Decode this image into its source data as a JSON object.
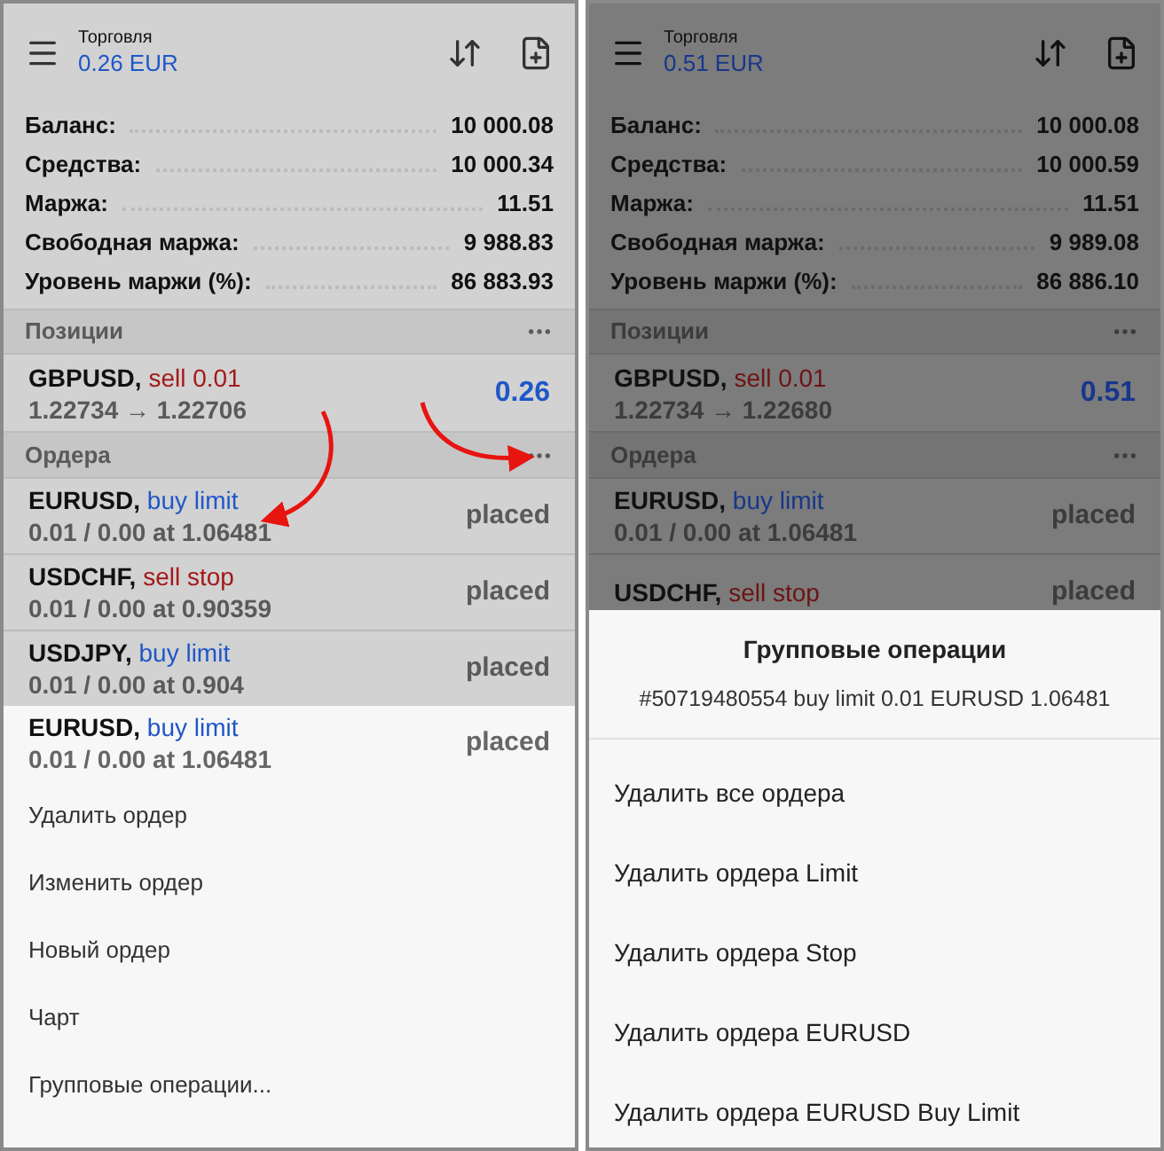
{
  "panels": [
    {
      "kind": "context_menu",
      "header": {
        "title": "Торговля",
        "profit": "0.26 EUR"
      },
      "account": [
        {
          "label": "Баланс:",
          "value": "10 000.08"
        },
        {
          "label": "Средства:",
          "value": "10 000.34"
        },
        {
          "label": "Маржа:",
          "value": "11.51"
        },
        {
          "label": "Свободная маржа:",
          "value": "9 988.83"
        },
        {
          "label": "Уровень маржи (%):",
          "value": "86 883.93"
        }
      ],
      "positions": {
        "title": "Позиции",
        "items": [
          {
            "symbol": "GBPUSD,",
            "kind": "sell",
            "trade": "sell 0.01",
            "prices": "1.22734 → 1.22706",
            "profit": "0.26"
          }
        ]
      },
      "orders": {
        "title": "Ордера",
        "items": [
          {
            "symbol": "EURUSD,",
            "kind": "buy",
            "type": "buy limit",
            "details": "0.01 / 0.00 at 1.06481",
            "status": "placed"
          },
          {
            "symbol": "USDCHF,",
            "kind": "sell",
            "type": "sell stop",
            "details": "0.01 / 0.00 at 0.90359",
            "status": "placed"
          },
          {
            "symbol": "USDJPY,",
            "kind": "buy",
            "type": "buy limit",
            "details": "0.01 / 0.00 at 0.904",
            "status": "placed"
          }
        ]
      },
      "popup": {
        "selected_order": {
          "symbol": "EURUSD,",
          "kind": "buy",
          "type": "buy limit",
          "details": "0.01 / 0.00 at 1.06481",
          "status": "placed"
        },
        "items": [
          "Удалить ордер",
          "Изменить ордер",
          "Новый ордер",
          "Чарт",
          "Групповые операции..."
        ]
      }
    },
    {
      "kind": "dialog",
      "header": {
        "title": "Торговля",
        "profit": "0.51 EUR"
      },
      "account": [
        {
          "label": "Баланс:",
          "value": "10 000.08"
        },
        {
          "label": "Средства:",
          "value": "10 000.59"
        },
        {
          "label": "Маржа:",
          "value": "11.51"
        },
        {
          "label": "Свободная маржа:",
          "value": "9 989.08"
        },
        {
          "label": "Уровень маржи (%):",
          "value": "86 886.10"
        }
      ],
      "positions": {
        "title": "Позиции",
        "items": [
          {
            "symbol": "GBPUSD,",
            "kind": "sell",
            "trade": "sell 0.01",
            "prices": "1.22734 → 1.22680",
            "profit": "0.51"
          }
        ]
      },
      "orders": {
        "title": "Ордера",
        "items": [
          {
            "symbol": "EURUSD,",
            "kind": "buy",
            "type": "buy limit",
            "details": "0.01 / 0.00 at 1.06481",
            "status": "placed"
          },
          {
            "symbol": "USDCHF,",
            "kind": "sell",
            "type": "sell stop",
            "status": "placed"
          }
        ]
      },
      "popup": {
        "title": "Групповые операции",
        "subtitle": "#50719480554 buy limit 0.01 EURUSD 1.06481",
        "items": [
          "Удалить все ордера",
          "Удалить ордера Limit",
          "Удалить ордера Stop",
          "Удалить ордера EURUSD",
          "Удалить ордера EURUSD Buy Limit"
        ]
      }
    }
  ]
}
